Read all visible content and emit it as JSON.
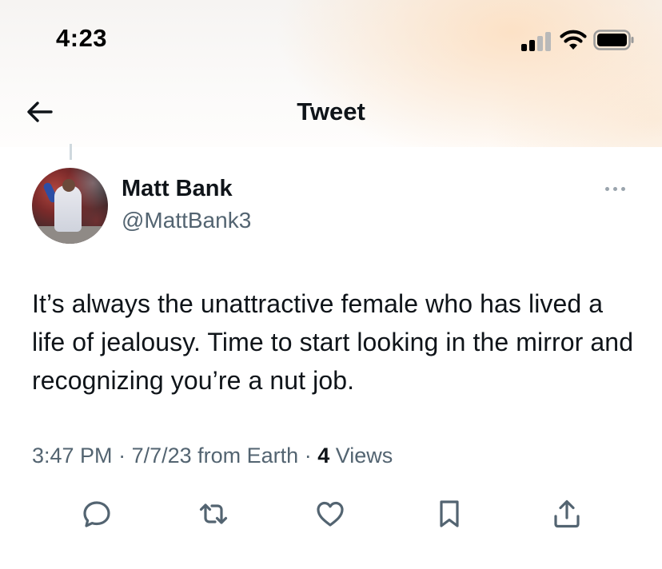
{
  "status_bar": {
    "time": "4:23",
    "signal_icon": "cellular-signal-icon",
    "wifi_icon": "wifi-icon",
    "battery_icon": "battery-icon"
  },
  "header": {
    "back_icon": "arrow-left-icon",
    "title": "Tweet"
  },
  "tweet": {
    "author": {
      "display_name": "Matt Bank",
      "handle": "@MattBank3",
      "avatar": "avatar-photo"
    },
    "more_icon": "more-dots-icon",
    "text": "It’s always the unattractive female who has lived a life of jealousy. Time to start looking in the mirror and recognizing you’re a nut job.",
    "meta": {
      "time": "3:47 PM",
      "separator": " · ",
      "date": "7/7/23",
      "source": " from Earth",
      "views_count": "4",
      "views_label": " Views"
    },
    "actions": [
      {
        "icon": "reply-icon"
      },
      {
        "icon": "retweet-icon"
      },
      {
        "icon": "like-heart-icon"
      },
      {
        "icon": "bookmark-icon"
      },
      {
        "icon": "share-icon"
      }
    ]
  },
  "colors": {
    "text_primary": "#0f1419",
    "text_secondary": "#536471",
    "icon": "#536471",
    "header_glow": "#fde0c4"
  }
}
